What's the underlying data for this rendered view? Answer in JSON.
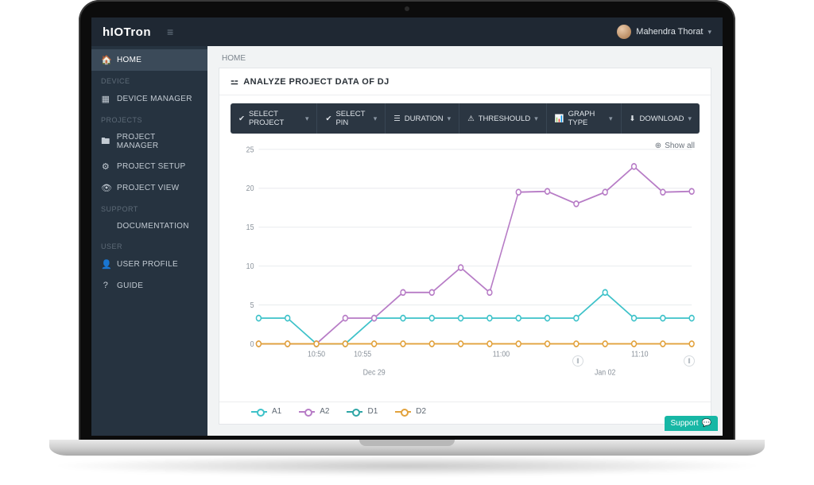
{
  "brand": "hIOTron",
  "user": {
    "name": "Mahendra Thorat"
  },
  "breadcrumb": "HOME",
  "page_title": "ANALYZE PROJECT DATA OF DJ",
  "sidebar": {
    "items": [
      {
        "icon": "home-icon",
        "label": "HOME",
        "active": true
      },
      {
        "section": "DEVICE"
      },
      {
        "icon": "chip-icon",
        "label": "DEVICE MANAGER"
      },
      {
        "section": "PROJECTS"
      },
      {
        "icon": "folder-icon",
        "label": "PROJECT MANAGER"
      },
      {
        "icon": "gear-icon",
        "label": "PROJECT SETUP"
      },
      {
        "icon": "eye-icon",
        "label": "PROJECT VIEW"
      },
      {
        "section": "SUPPORT"
      },
      {
        "icon": "",
        "label": "DOCUMENTATION"
      },
      {
        "section": "USER"
      },
      {
        "icon": "user-icon",
        "label": "USER PROFILE"
      },
      {
        "icon": "question-icon",
        "label": "GUIDE"
      }
    ]
  },
  "filters": [
    {
      "icon": "check-icon",
      "label": "SELECT PROJECT"
    },
    {
      "icon": "check-icon",
      "label": "SELECT PIN"
    },
    {
      "icon": "list-icon",
      "label": "DURATION"
    },
    {
      "icon": "warning-icon",
      "label": "THRESHOULD"
    },
    {
      "icon": "chart-icon",
      "label": "GRAPH TYPE"
    },
    {
      "icon": "download-icon",
      "label": "DOWNLOAD"
    }
  ],
  "show_all_label": "Show all",
  "support_label": "Support",
  "legend": [
    "A1",
    "A2",
    "D1",
    "D2"
  ],
  "chart_data": {
    "type": "line",
    "ylim": [
      0,
      25
    ],
    "yticks": [
      0,
      5,
      10,
      15,
      20,
      25
    ],
    "x_major": [
      "Dec 29",
      "Jan 02"
    ],
    "x_ticks": [
      "10:50",
      "10:55",
      "",
      "",
      "11:00",
      "",
      "",
      "11:10",
      ""
    ],
    "x": [
      0,
      1,
      2,
      3,
      4,
      5,
      6,
      7,
      8,
      9,
      10,
      11,
      12,
      13,
      14,
      15
    ],
    "series": [
      {
        "name": "A1",
        "color": "#3ec2c9",
        "values": [
          3.3,
          3.3,
          0,
          0,
          3.3,
          3.3,
          3.3,
          3.3,
          3.3,
          3.3,
          3.3,
          3.3,
          6.6,
          3.3,
          3.3,
          3.3
        ]
      },
      {
        "name": "A2",
        "color": "#b77cc6",
        "values": [
          0,
          0,
          0,
          3.3,
          3.3,
          6.6,
          6.6,
          9.8,
          6.6,
          19.5,
          19.6,
          18.0,
          19.5,
          22.8,
          19.5,
          19.6
        ]
      },
      {
        "name": "D1",
        "color": "#2fa6a6",
        "values": [
          null,
          null,
          null,
          null,
          null,
          null,
          null,
          null,
          null,
          null,
          null,
          null,
          null,
          null,
          null,
          null
        ]
      },
      {
        "name": "D2",
        "color": "#e2a23c",
        "values": [
          0,
          0,
          0,
          0,
          0,
          0,
          0,
          0,
          0,
          0,
          0,
          0,
          0,
          0,
          0,
          0
        ]
      }
    ]
  }
}
